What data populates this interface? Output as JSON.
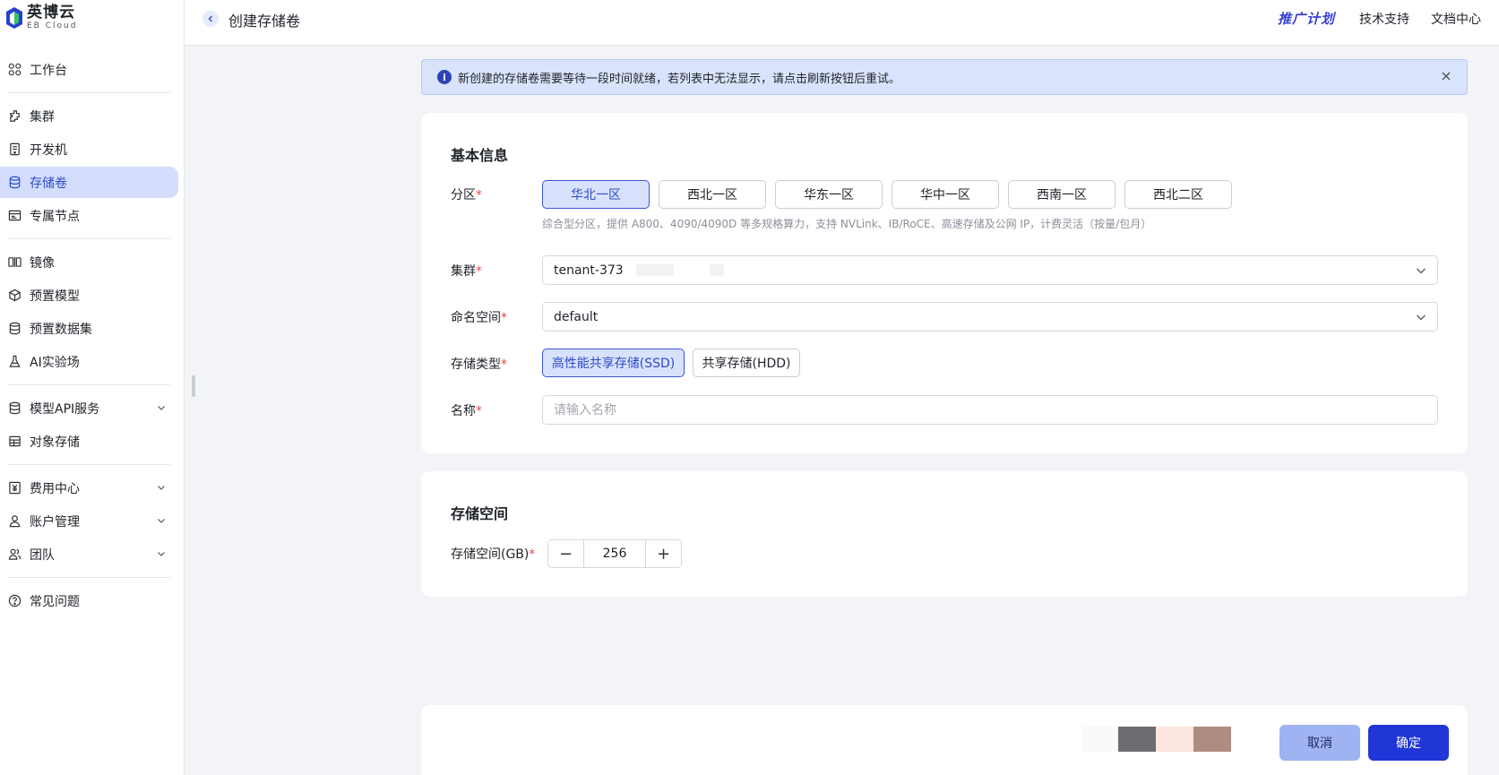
{
  "brand": {
    "name_cn": "英博云",
    "name_en": "EB Cloud"
  },
  "sidebar": {
    "items": [
      {
        "label": "工作台",
        "icon": "dashboard-icon"
      },
      {
        "label": "集群",
        "icon": "cluster-icon"
      },
      {
        "label": "开发机",
        "icon": "devbox-icon"
      },
      {
        "label": "存储卷",
        "icon": "database-icon",
        "active": true
      },
      {
        "label": "专属节点",
        "icon": "node-icon"
      },
      {
        "label": "镜像",
        "icon": "image-icon"
      },
      {
        "label": "预置模型",
        "icon": "cube-icon"
      },
      {
        "label": "预置数据集",
        "icon": "dataset-icon"
      },
      {
        "label": "AI实验场",
        "icon": "flask-icon"
      },
      {
        "label": "模型API服务",
        "icon": "api-icon",
        "expandable": true
      },
      {
        "label": "对象存储",
        "icon": "storage-icon"
      },
      {
        "label": "费用中心",
        "icon": "yen-icon",
        "expandable": true
      },
      {
        "label": "账户管理",
        "icon": "user-icon",
        "expandable": true
      },
      {
        "label": "团队",
        "icon": "team-icon",
        "expandable": true
      },
      {
        "label": "常见问题",
        "icon": "question-icon"
      }
    ]
  },
  "header": {
    "title": "创建存储卷",
    "promo": "推广计划",
    "links": [
      "技术支持",
      "文档中心"
    ]
  },
  "alert": {
    "text": "新创建的存储卷需要等待一段时间就绪，若列表中无法显示，请点击刷新按钮后重试。"
  },
  "basic_info": {
    "title": "基本信息",
    "region_label": "分区",
    "regions": [
      "华北一区",
      "西北一区",
      "华东一区",
      "华中一区",
      "西南一区",
      "西北二区"
    ],
    "selected_region": "华北一区",
    "region_hint": "综合型分区，提供 A800、4090/4090D 等多规格算力，支持 NVLink、IB/RoCE、高速存储及公网 IP，计费灵活（按量/包月）",
    "cluster_label": "集群",
    "cluster_value": "tenant-373",
    "namespace_label": "命名空间",
    "namespace_value": "default",
    "storage_type_label": "存储类型",
    "storage_types": [
      "高性能共享存储(SSD)",
      "共享存储(HDD)"
    ],
    "selected_storage_type": "高性能共享存储(SSD)",
    "name_label": "名称",
    "name_placeholder": "请输入名称",
    "required_mark": "*"
  },
  "storage_space": {
    "title": "存储空间",
    "label": "存储空间(GB)",
    "value": "256",
    "minus": "−",
    "plus": "+"
  },
  "footer": {
    "cancel": "取消",
    "confirm": "确定",
    "swatch_colors": [
      "#fafafa",
      "#6d6c72",
      "#fde6df",
      "#b08c80"
    ]
  },
  "colors": {
    "accent": "#2036d6",
    "active_bg": "#d4defc",
    "alert_bg": "#d9e3fb"
  }
}
